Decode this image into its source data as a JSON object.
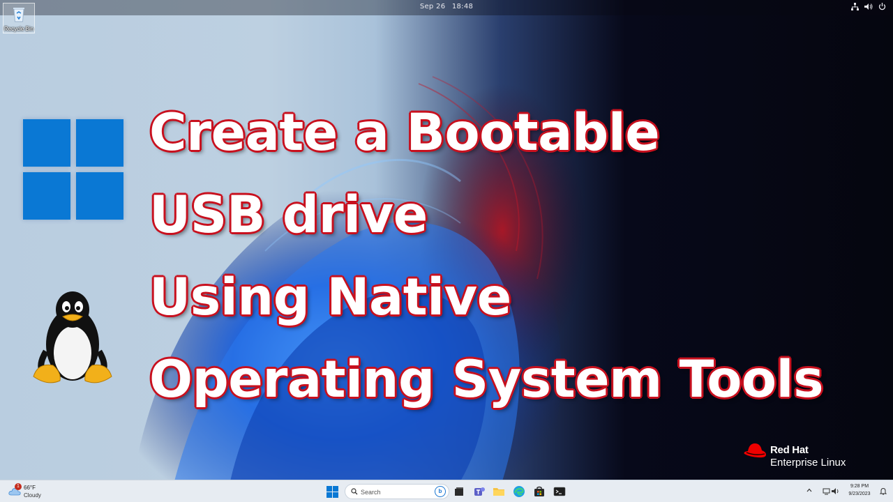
{
  "topbar": {
    "date": "Sep 26",
    "time": "18:48",
    "icons": [
      "network-icon",
      "volume-icon",
      "power-icon"
    ]
  },
  "desktop": {
    "icons": [
      {
        "label": "Recycle Bin",
        "icon": "recycle-bin-icon"
      }
    ]
  },
  "headline": {
    "lines": [
      "Create a Bootable",
      "USB drive",
      "Using Native",
      "Operating System Tools"
    ]
  },
  "brand": {
    "name": "Red Hat",
    "product": "Enterprise Linux"
  },
  "taskbar": {
    "weather": {
      "temp": "66°F",
      "condition": "Cloudy",
      "badge": "1"
    },
    "search_placeholder": "Search",
    "bing_label": "b",
    "apps": [
      "task-view-icon",
      "teams-icon",
      "file-explorer-icon",
      "edge-icon",
      "store-icon",
      "terminal-icon"
    ],
    "clock": {
      "time": "9:28 PM",
      "date": "9/23/2023"
    }
  },
  "colors": {
    "windows_blue": "#0a78d4",
    "headline_outline": "#c8101e",
    "redhat_red": "#ee0000",
    "taskbar_bg": "#e7ecf2"
  }
}
